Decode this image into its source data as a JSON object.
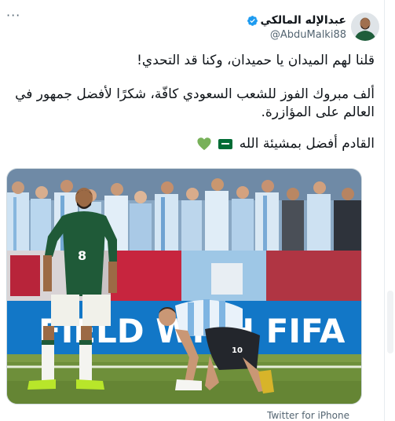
{
  "author": {
    "display_name": "عبدالإله المالكي",
    "handle": "@AbduMalki88",
    "verified": true
  },
  "tweet": {
    "line1": "قلنا لهم الميدان يا حميدان، وكنا قد التحدي!",
    "line2": "ألف مبروك الفوز للشعب السعودي كافّة، شكرًا لأفضل جمهور في العالم على المؤازرة.",
    "line3": "القادم أفضل بمشيئة الله"
  },
  "photo": {
    "board_text": "FIELD WITH FIFA",
    "player1_number": "8",
    "player2_number": "10"
  },
  "footer": {
    "source": "Twitter for iPhone"
  },
  "colors": {
    "verified": "#1d9bf0",
    "heart": "#78b159",
    "saudi_green": "#006c35"
  },
  "icons": {
    "more": "more-icon",
    "verified": "verified-badge-icon",
    "heart": "green-heart-icon",
    "flag": "saudi-flag-icon"
  }
}
